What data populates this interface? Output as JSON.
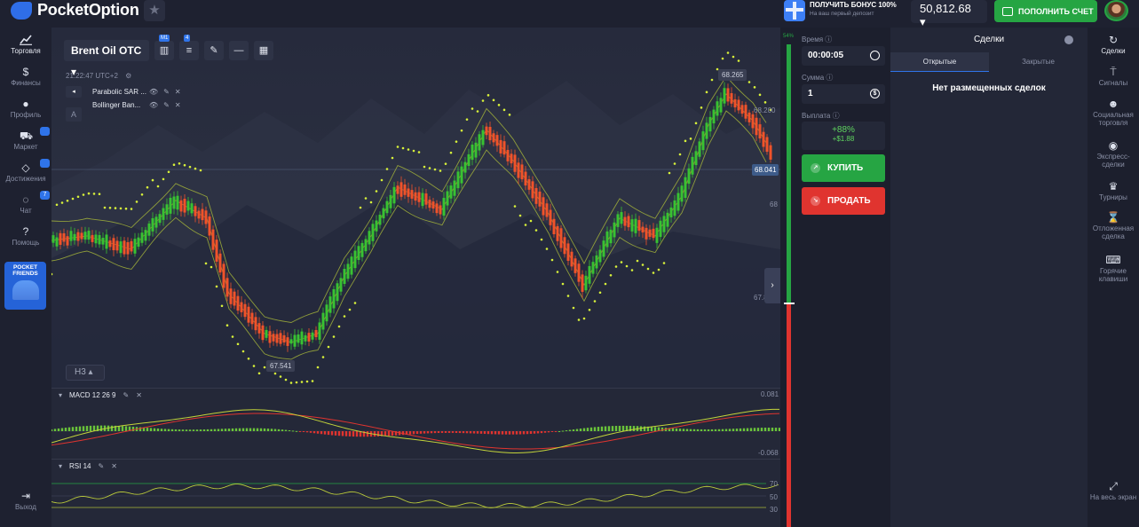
{
  "topbar": {
    "logo_text": "PocketOption",
    "bonus_title": "ПОЛУЧИТЬ БОНУС 100%",
    "bonus_sub": "На ваш первый депозит",
    "balance": "50,812.68 ▾",
    "deposit_label": "ПОПОЛНИТЬ СЧЕТ"
  },
  "left_nav": [
    {
      "label": "Торговля",
      "icon": "chart-icon"
    },
    {
      "label": "Финансы",
      "icon": "dollar-icon"
    },
    {
      "label": "Профиль",
      "icon": "user-icon"
    },
    {
      "label": "Маркет",
      "icon": "cart-icon",
      "badge": ""
    },
    {
      "label": "Достижения",
      "icon": "diamond-icon",
      "badge": ""
    },
    {
      "label": "Чат",
      "icon": "chat-icon",
      "badge": "7"
    },
    {
      "label": "Помощь",
      "icon": "help-icon"
    },
    {
      "label": "Выход",
      "icon": "exit-icon"
    }
  ],
  "pocket_friends": "POCKET FRIENDS",
  "chart": {
    "asset": "Brent Oil OTC ▾",
    "timeframe_badge": "M1",
    "indicator_badge": "4",
    "clock": "21:22:47 UTC+2",
    "indicators": [
      "Parabolic SAR ...",
      "Bollinger Ban..."
    ],
    "a_label": "A",
    "tf_button": "H3 ▴",
    "high_label": "68.265",
    "low_label": "67.541",
    "current_price": "68.041",
    "axis": [
      "68.200",
      "68",
      "67.800"
    ],
    "macd_title": "MACD 12 26 9",
    "macd_axis_top": "0.081",
    "macd_axis_bottom": "-0.068",
    "rsi_title": "RSI 14",
    "rsi_axis": [
      "70",
      "50",
      "30"
    ]
  },
  "trade": {
    "pct_top": "54%",
    "time_label": "Время ⓘ",
    "time_value": "00:00:05",
    "amount_label": "Сумма ⓘ",
    "amount_value": "1",
    "payout_label": "Выплата ⓘ",
    "payout_pct": "+88%",
    "payout_amount": "+$1.88",
    "buy": "КУПИТЬ",
    "sell": "ПРОДАТЬ"
  },
  "deals": {
    "title": "Сделки",
    "tab_open": "Открытые",
    "tab_closed": "Закрытые",
    "empty": "Нет размещенных сделок"
  },
  "right_nav": [
    {
      "label": "Сделки",
      "icon": "deals-icon"
    },
    {
      "label": "Сигналы",
      "icon": "signal-icon"
    },
    {
      "label": "Социальная торговля",
      "icon": "social-icon"
    },
    {
      "label": "Экспресс-сделки",
      "icon": "express-icon"
    },
    {
      "label": "Турниры",
      "icon": "trophy-icon"
    },
    {
      "label": "Отложенная сделка",
      "icon": "hourglass-icon"
    },
    {
      "label": "Горячие клавиши",
      "icon": "keyboard-icon"
    },
    {
      "label": "На весь экран",
      "icon": "fullscreen-icon"
    }
  ]
}
